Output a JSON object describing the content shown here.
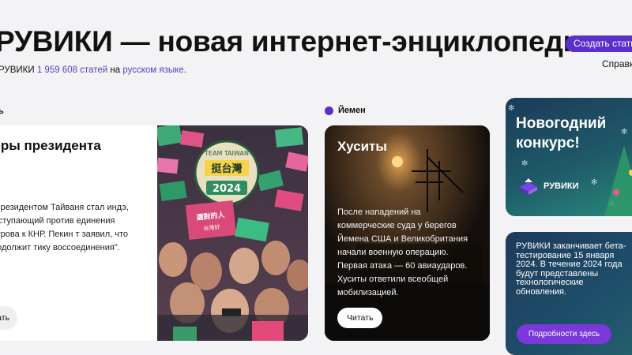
{
  "header": {
    "title": "РУВИКИ — новая интернет-энциклопедия",
    "stats_prefix": "РУВИКИ ",
    "stats_count": "1 959 608 статей",
    "stats_middle": " на ",
    "stats_language": "русском языке",
    "stats_suffix": ".",
    "create_button": "Создать статью",
    "help_link": "Справка"
  },
  "cards": {
    "taiwan": {
      "tag": "ь",
      "title": "боры президента",
      "body": "м президентом Тайваня стал индэ, выступающий против единения острова к КНР. Пекин т заявил, что продолжит тику воссоединения\".",
      "read": "ать",
      "photo_sign_text": "TEAM TAIWAN 挺台灣 2024",
      "photo_flag_text": "選對的人 台灣好",
      "photo_alt": "Толпа сторонников с флагами на митинге"
    },
    "yemen": {
      "tag": "Йемен",
      "title": "Хуситы",
      "body": "После нападений на коммерческие суда у берегов Йемена США и Великобритания начали военную операцию. Первая атака — 60 авиаударов. Хуситы ответили всеобщей мобилизацией.",
      "read": "Читать"
    },
    "contest": {
      "title_line1": "Новогодний",
      "title_line2": "конкурс!",
      "logo_text": "РУВИКИ"
    },
    "beta": {
      "body": "РУВИКИ заканчивает бета-тестирование 15 января 2024. В течение 2024 года будут представлены технологические обновления.",
      "button": "Подробности здесь"
    }
  },
  "colors": {
    "accent": "#5b2fc9",
    "link": "#5a3fc0"
  }
}
